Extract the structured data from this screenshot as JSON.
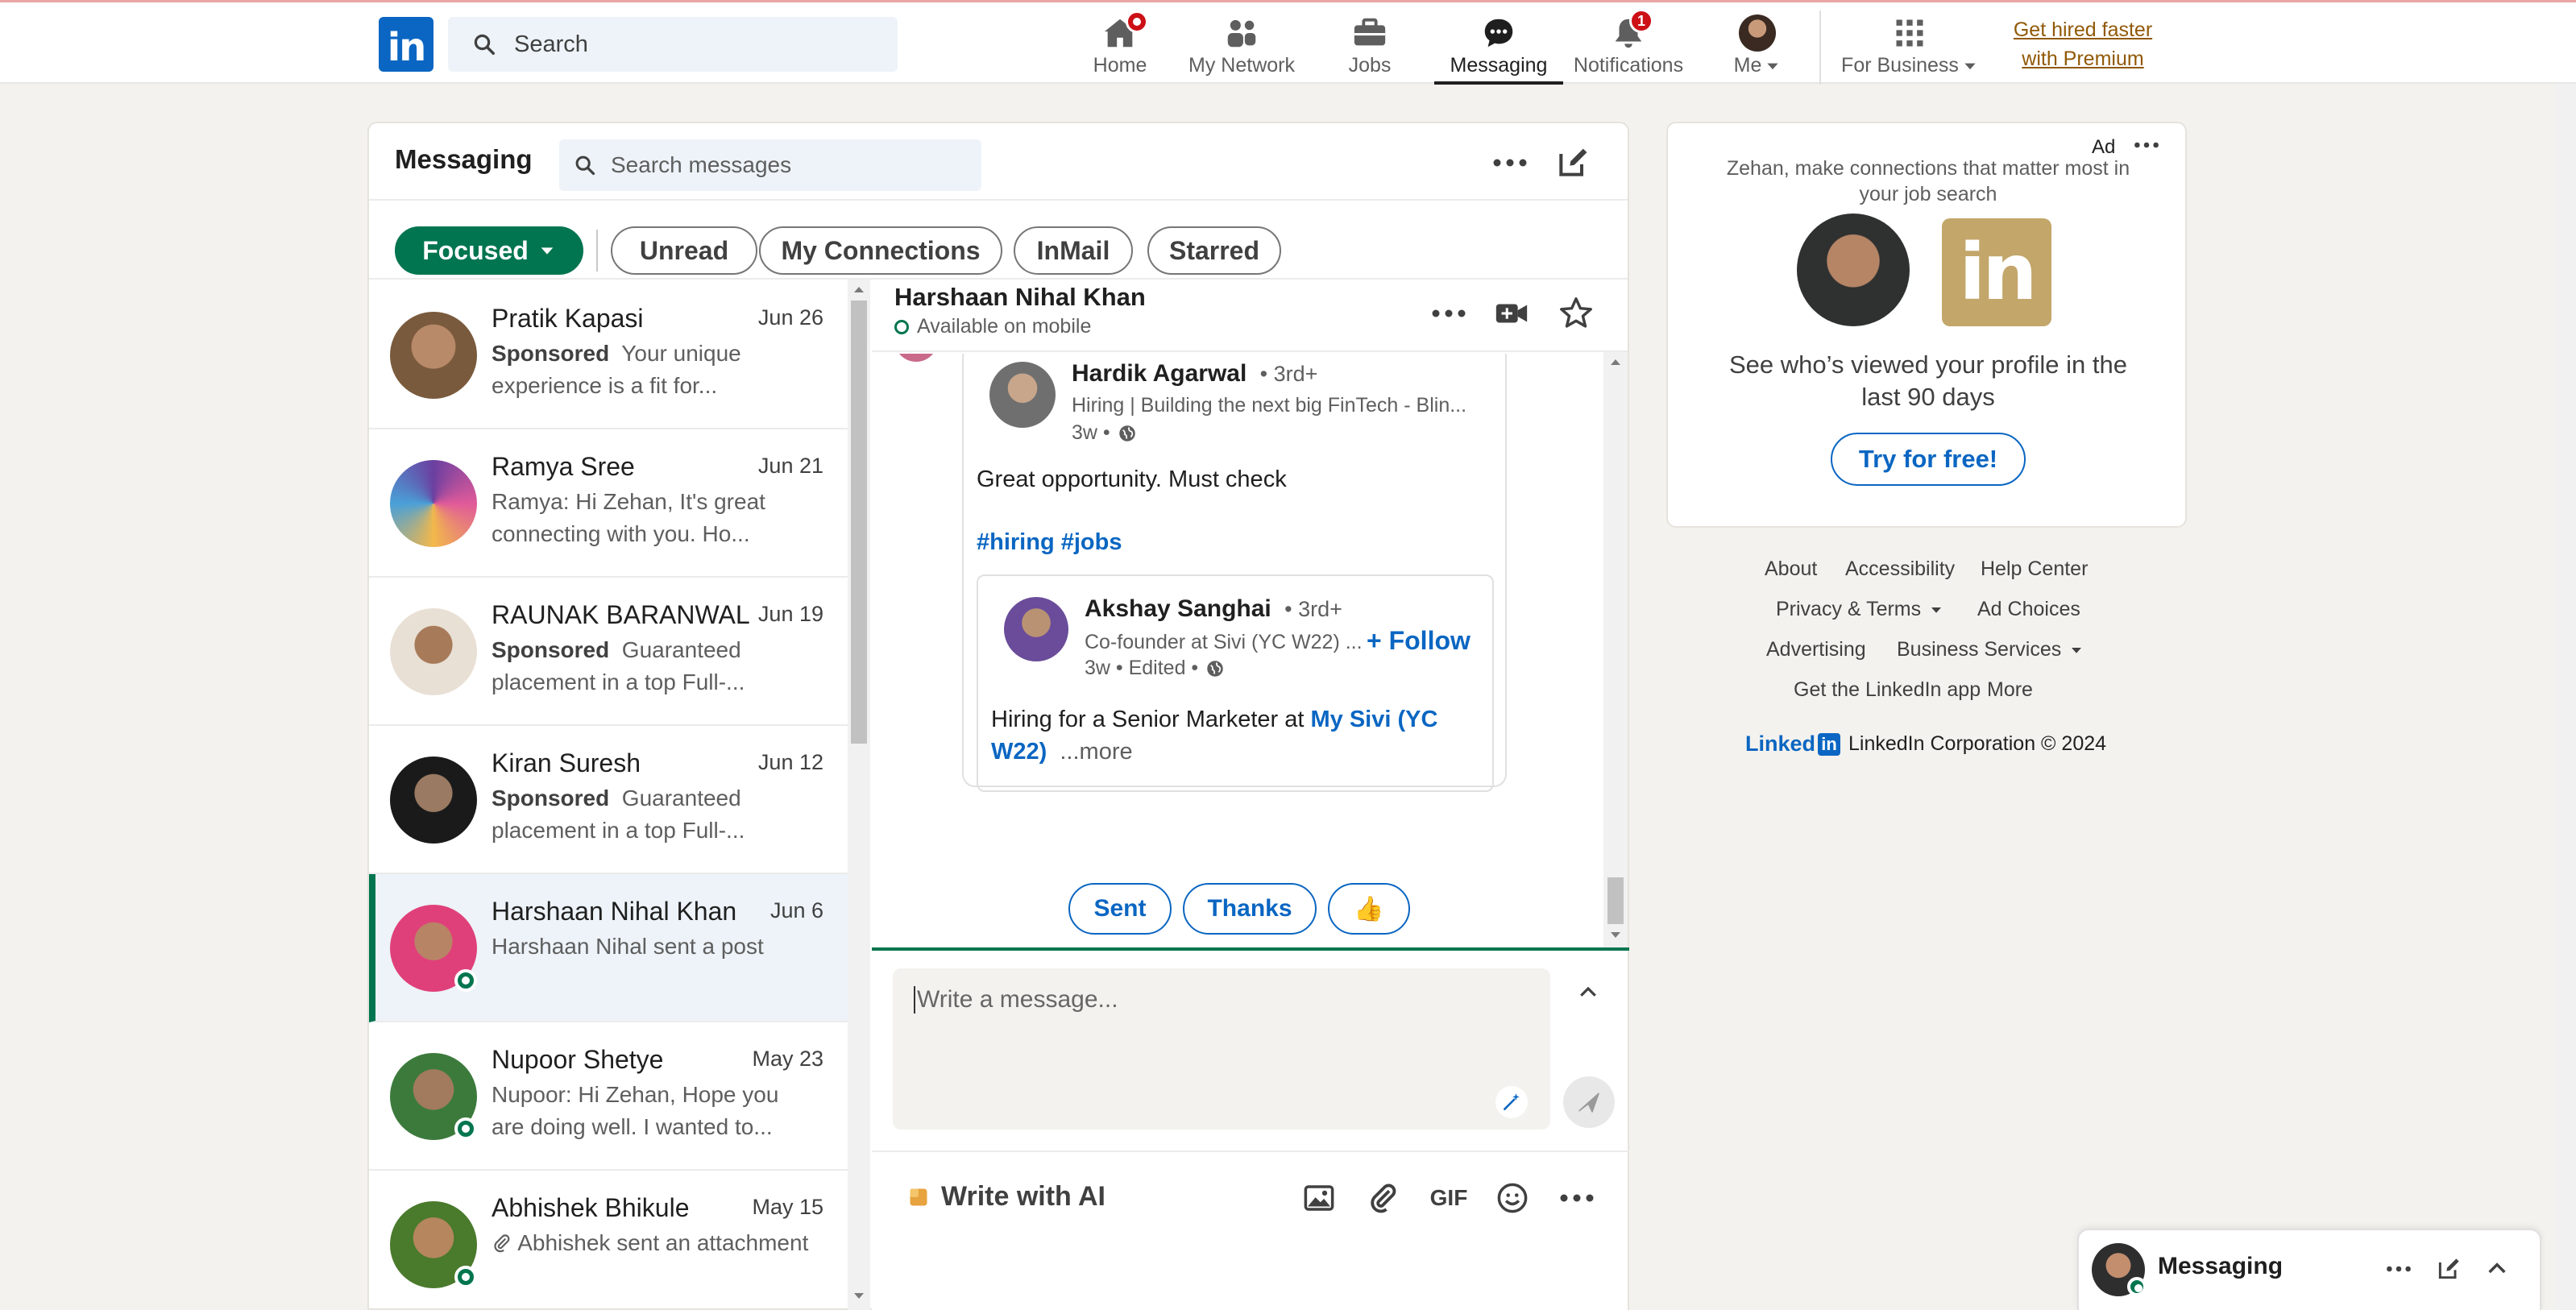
{
  "topnav": {
    "search_placeholder": "Search",
    "items": [
      {
        "label": "Home",
        "icon": "home-icon"
      },
      {
        "label": "My Network",
        "icon": "people-icon"
      },
      {
        "label": "Jobs",
        "icon": "briefcase-icon"
      },
      {
        "label": "Messaging",
        "icon": "chat-icon"
      },
      {
        "label": "Notifications",
        "icon": "bell-icon",
        "badge": "1"
      },
      {
        "label": "Me",
        "icon": "avatar-icon"
      },
      {
        "label": "For Business",
        "icon": "grid-icon"
      }
    ],
    "premium_line1": "Get hired faster",
    "premium_line2": "with Premium"
  },
  "messaging": {
    "title": "Messaging",
    "search_placeholder": "Search messages",
    "filters": [
      "Focused",
      "Unread",
      "My Connections",
      "InMail",
      "Starred"
    ],
    "conversations": [
      {
        "name": "Pratik Kapasi",
        "date": "Jun 26",
        "sponsored": "Sponsored",
        "snippet": "Your unique experience is a fit for...",
        "avatar_color": "#7a5a3c"
      },
      {
        "name": "Ramya Sree",
        "date": "Jun 21",
        "sponsored": "",
        "snippet": "Ramya: Hi Zehan, It's great connecting with you. Ho...",
        "avatar_color": "#6b3fa0"
      },
      {
        "name": "RAUNAK BARANWAL",
        "date": "Jun 19",
        "sponsored": "Sponsored",
        "snippet": "Guaranteed placement in a top Full-...",
        "avatar_color": "#c9b9a6"
      },
      {
        "name": "Kiran Suresh",
        "date": "Jun 12",
        "sponsored": "Sponsored",
        "snippet": "Guaranteed placement in a top Full-...",
        "avatar_color": "#2b2b2b"
      },
      {
        "name": "Harshaan Nihal Khan",
        "date": "Jun 6",
        "sponsored": "",
        "snippet": "Harshaan Nihal sent a post",
        "avatar_color": "#e0407a"
      },
      {
        "name": "Nupoor Shetye",
        "date": "May 23",
        "sponsored": "",
        "snippet": "Nupoor: Hi Zehan, Hope you are doing well. I wanted to...",
        "avatar_color": "#3c7a3c"
      },
      {
        "name": "Abhishek Bhikule",
        "date": "May 15",
        "sponsored": "",
        "snippet": "Abhishek sent an attachment",
        "avatar_color": "#4a7a2c"
      }
    ]
  },
  "conversation": {
    "name": "Harshaan Nihal Khan",
    "status": "Available on mobile",
    "post": {
      "author": "Hardik Agarwal",
      "degree": "• 3rd+",
      "headline": "Hiring | Building the next big FinTech - Blin...",
      "time": "3w •",
      "text": "Great opportunity. Must check",
      "hashtags": "#hiring #jobs",
      "shared": {
        "author": "Akshay Sanghai",
        "degree": "• 3rd+",
        "headline": "Co-founder at Sivi (YC W22) ...",
        "time": "3w • Edited •",
        "follow": "+ Follow",
        "text": "Hiring for a Senior Marketer at ",
        "link": "My Sivi (YC W22)",
        "more": "...more"
      }
    },
    "quick_replies": [
      "Sent",
      "Thanks",
      "👍"
    ],
    "compose_placeholder": "Write a message...",
    "write_ai": "Write with AI",
    "gif": "GIF"
  },
  "ad": {
    "label": "Ad",
    "headline": "Zehan, make connections that matter most in your job search",
    "body": "See who’s viewed your profile in the last 90 days",
    "cta": "Try for free!"
  },
  "footer": {
    "links": [
      "About",
      "Accessibility",
      "Help Center",
      "Privacy & Terms",
      "Ad Choices",
      "Advertising",
      "Business Services",
      "Get the LinkedIn app",
      "More"
    ],
    "brand": "Linked",
    "copyright": "LinkedIn Corporation © 2024"
  },
  "messaging_bar": {
    "title": "Messaging"
  },
  "colors": {
    "brand": "#0a66c2",
    "green": "#01754f",
    "premium": "#915907",
    "badge": "#cc1016"
  }
}
